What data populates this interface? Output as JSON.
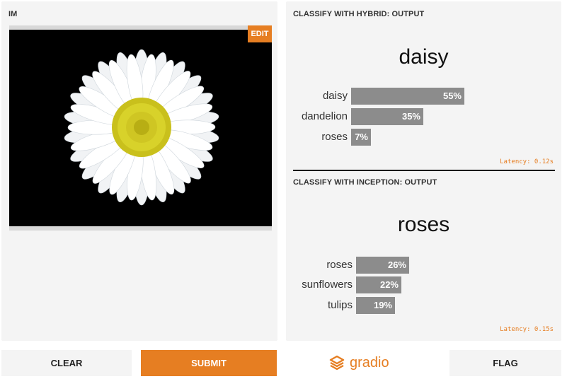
{
  "input": {
    "label": "IM",
    "edit_label": "EDIT",
    "image_subject": "daisy-flower-photo"
  },
  "outputs": [
    {
      "title": "CLASSIFY WITH HYBRID: OUTPUT",
      "top_class": "daisy",
      "bars": [
        {
          "label": "daisy",
          "value": 55,
          "text": "55%"
        },
        {
          "label": "dandelion",
          "value": 35,
          "text": "35%"
        },
        {
          "label": "roses",
          "value": 7,
          "text": "7%"
        }
      ],
      "latency": "Latency: 0.12s"
    },
    {
      "title": "CLASSIFY WITH INCEPTION: OUTPUT",
      "top_class": "roses",
      "bars": [
        {
          "label": "roses",
          "value": 26,
          "text": "26%"
        },
        {
          "label": "sunflowers",
          "value": 22,
          "text": "22%"
        },
        {
          "label": "tulips",
          "value": 19,
          "text": "19%"
        }
      ],
      "latency": "Latency: 0.15s"
    }
  ],
  "buttons": {
    "clear": "CLEAR",
    "submit": "SUBMIT",
    "flag": "FLAG"
  },
  "brand": {
    "name": "gradio",
    "icon": "gradio-logo-icon"
  },
  "colors": {
    "accent": "#e67e22",
    "bar": "#8c8c8c",
    "panel": "#f4f4f4"
  }
}
